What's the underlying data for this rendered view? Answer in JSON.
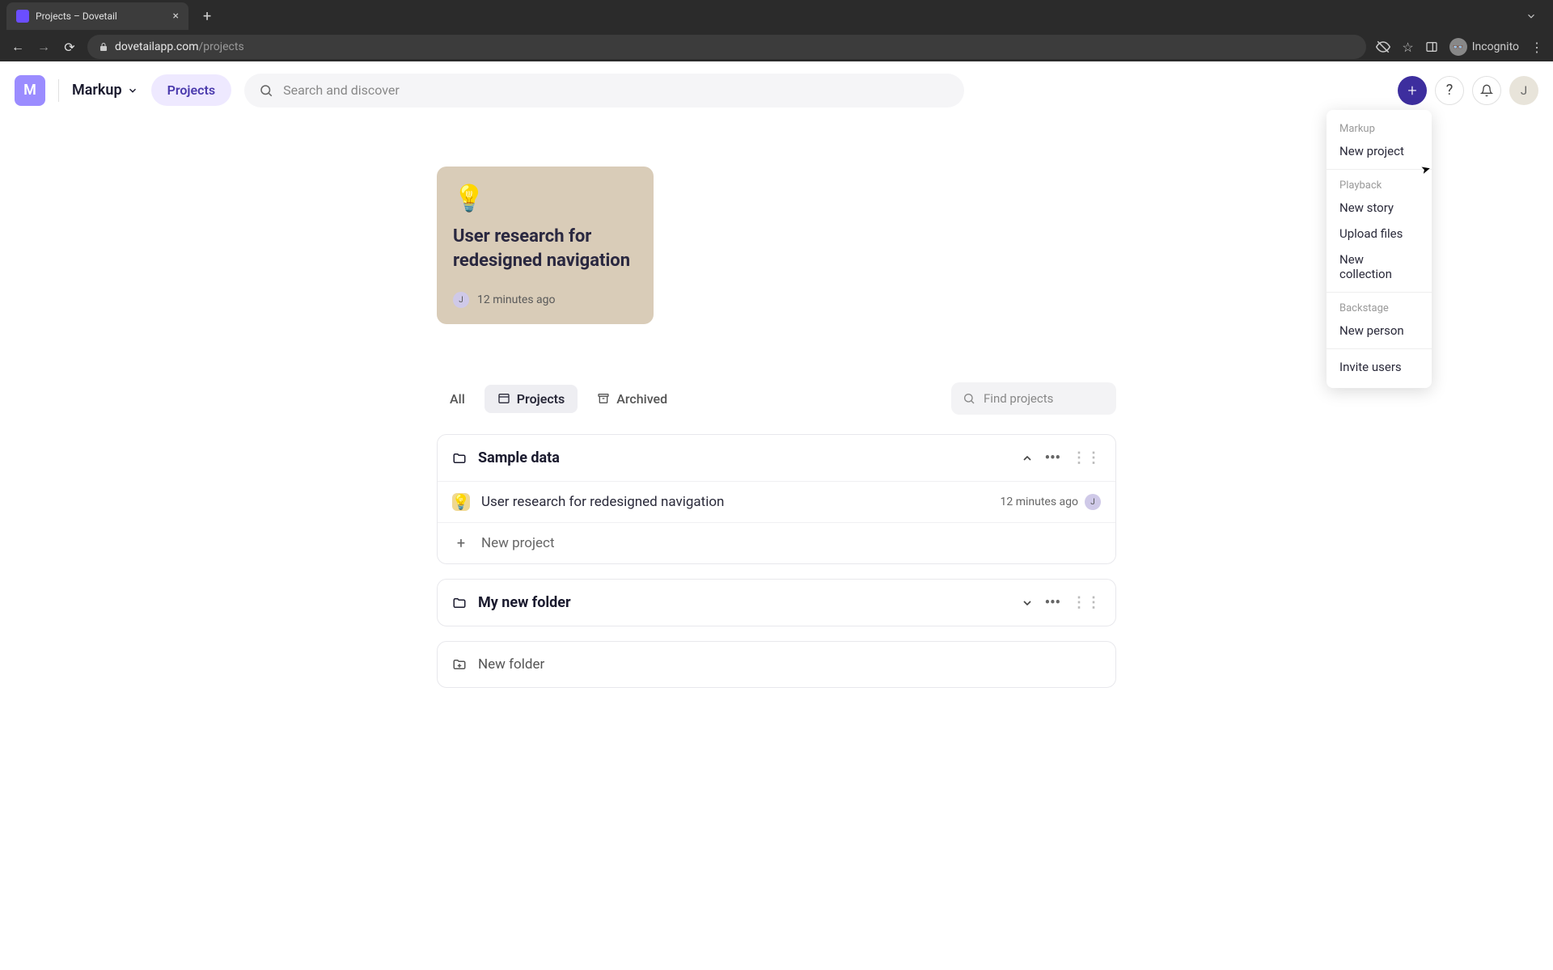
{
  "browser": {
    "tab_title": "Projects – Dovetail",
    "url_domain": "dovetailapp.com",
    "url_path": "/projects",
    "incognito_label": "Incognito"
  },
  "header": {
    "workspace_initial": "M",
    "workspace_name": "Markup",
    "nav_pill": "Projects",
    "search_placeholder": "Search and discover",
    "user_initial": "J"
  },
  "dropdown": {
    "sections": [
      {
        "label": "Markup",
        "items": [
          "New project"
        ]
      },
      {
        "label": "Playback",
        "items": [
          "New story",
          "Upload files",
          "New collection"
        ]
      },
      {
        "label": "Backstage",
        "items": [
          "New person"
        ]
      }
    ],
    "footer_item": "Invite users"
  },
  "card": {
    "title": "User research for redesigned navigation",
    "author_initial": "J",
    "timestamp": "12 minutes ago"
  },
  "filters": {
    "tabs": [
      "All",
      "Projects",
      "Archived"
    ],
    "active_index": 1,
    "find_placeholder": "Find projects"
  },
  "folders": [
    {
      "name": "Sample data",
      "expanded": true,
      "rows": [
        {
          "title": "User research for redesigned navigation",
          "timestamp": "12 minutes ago",
          "author_initial": "J"
        }
      ],
      "new_row_label": "New project"
    },
    {
      "name": "My new folder",
      "expanded": false,
      "rows": []
    }
  ],
  "new_folder_label": "New folder"
}
